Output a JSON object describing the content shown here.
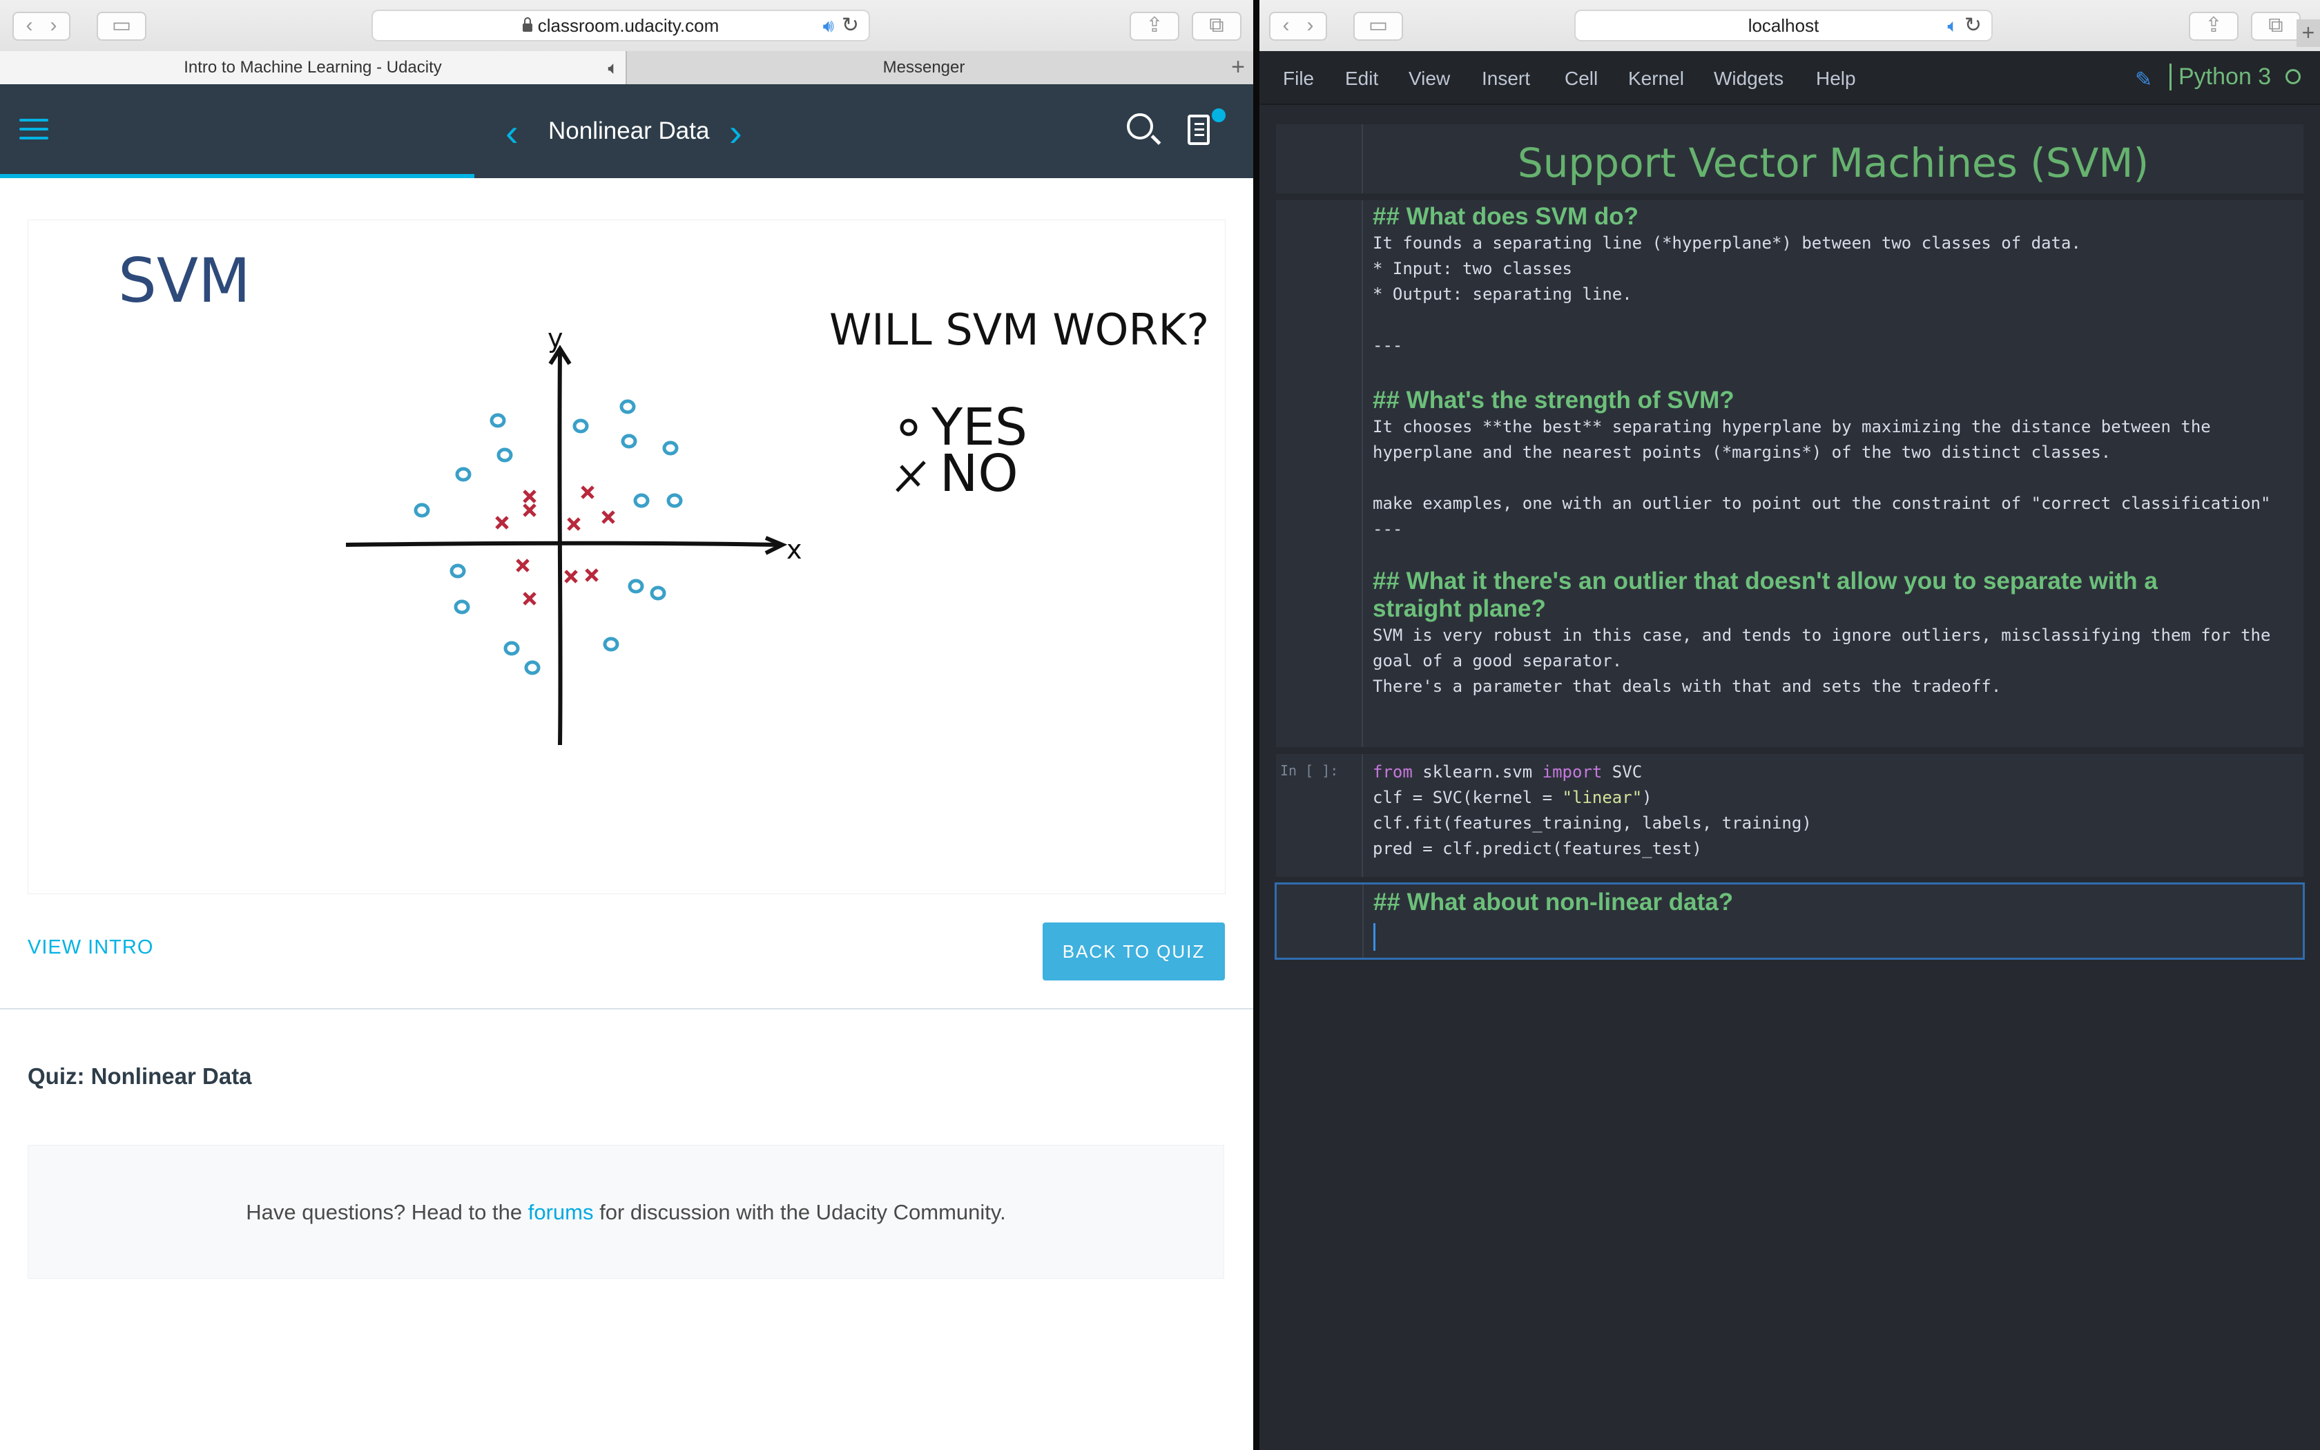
{
  "left_window": {
    "url": "classroom.udacity.com",
    "tabs": [
      {
        "label": "Intro to Machine Learning - Udacity",
        "active": true
      },
      {
        "label": "Messenger",
        "active": false
      }
    ],
    "nav": {
      "title": "Nonlinear Data",
      "prev_icon": "chevron-left-icon",
      "next_icon": "chevron-right-icon"
    },
    "drawing": {
      "svm_label": "SVM",
      "question": "WILL SVM WORK?",
      "option_yes": "YES",
      "option_no": "NO",
      "axis_x": "x",
      "axis_y": "y"
    },
    "view_intro": "VIEW INTRO",
    "back_to_quiz": "BACK TO QUIZ",
    "quiz_heading": "Quiz: Nonlinear Data",
    "forum_before": "Have questions? Head to the",
    "forum_link": "forums",
    "forum_after": "for discussion with the Udacity Community."
  },
  "right_window": {
    "url": "localhost",
    "menu": [
      "File",
      "Edit",
      "View",
      "Insert",
      "Cell",
      "Kernel",
      "Widgets",
      "Help"
    ],
    "kernel_name": "Python 3",
    "title_cell": "Support Vector Machines (SVM)",
    "md_cell": {
      "h_what": "## What does SVM do?",
      "line1": "It founds a separating line (*hyperplane*) between two classes of data.",
      "line2": "* Input: two classes",
      "line3": "* Output: separating line.",
      "sep1": "---",
      "h_strength": "## What's the strength of SVM?",
      "line4": "It chooses **the best** separating hyperplane by maximizing the distance between the",
      "line5": "hyperplane and the nearest points (*margins*) of the two distinct classes.",
      "line6": "make examples, one with an outlier to point out the constraint of \"correct classification\"",
      "sep2": "---",
      "h_outlier_1": "## What it there's an outlier that doesn't allow you to separate with a",
      "h_outlier_2": "straight plane?",
      "line7": "SVM is very robust in this case, and tends to ignore outliers, misclassifying them for the",
      "line8": "goal of a good separator.",
      "line9": "There's a parameter that deals with that and sets the tradeoff."
    },
    "code_cell": {
      "prompt": "In [ ]:",
      "kw_from": "from",
      "mod": " sklearn.svm ",
      "kw_import": "import",
      "cls": " SVC",
      "l2a": "clf = SVC(kernel = ",
      "l2str": "\"linear\"",
      "l2b": ")",
      "l3": "clf.fit(features_training, labels, training)",
      "l4": "pred = clf.predict(features_test)"
    },
    "active_cell": {
      "heading": "## What about non-linear data?"
    }
  }
}
